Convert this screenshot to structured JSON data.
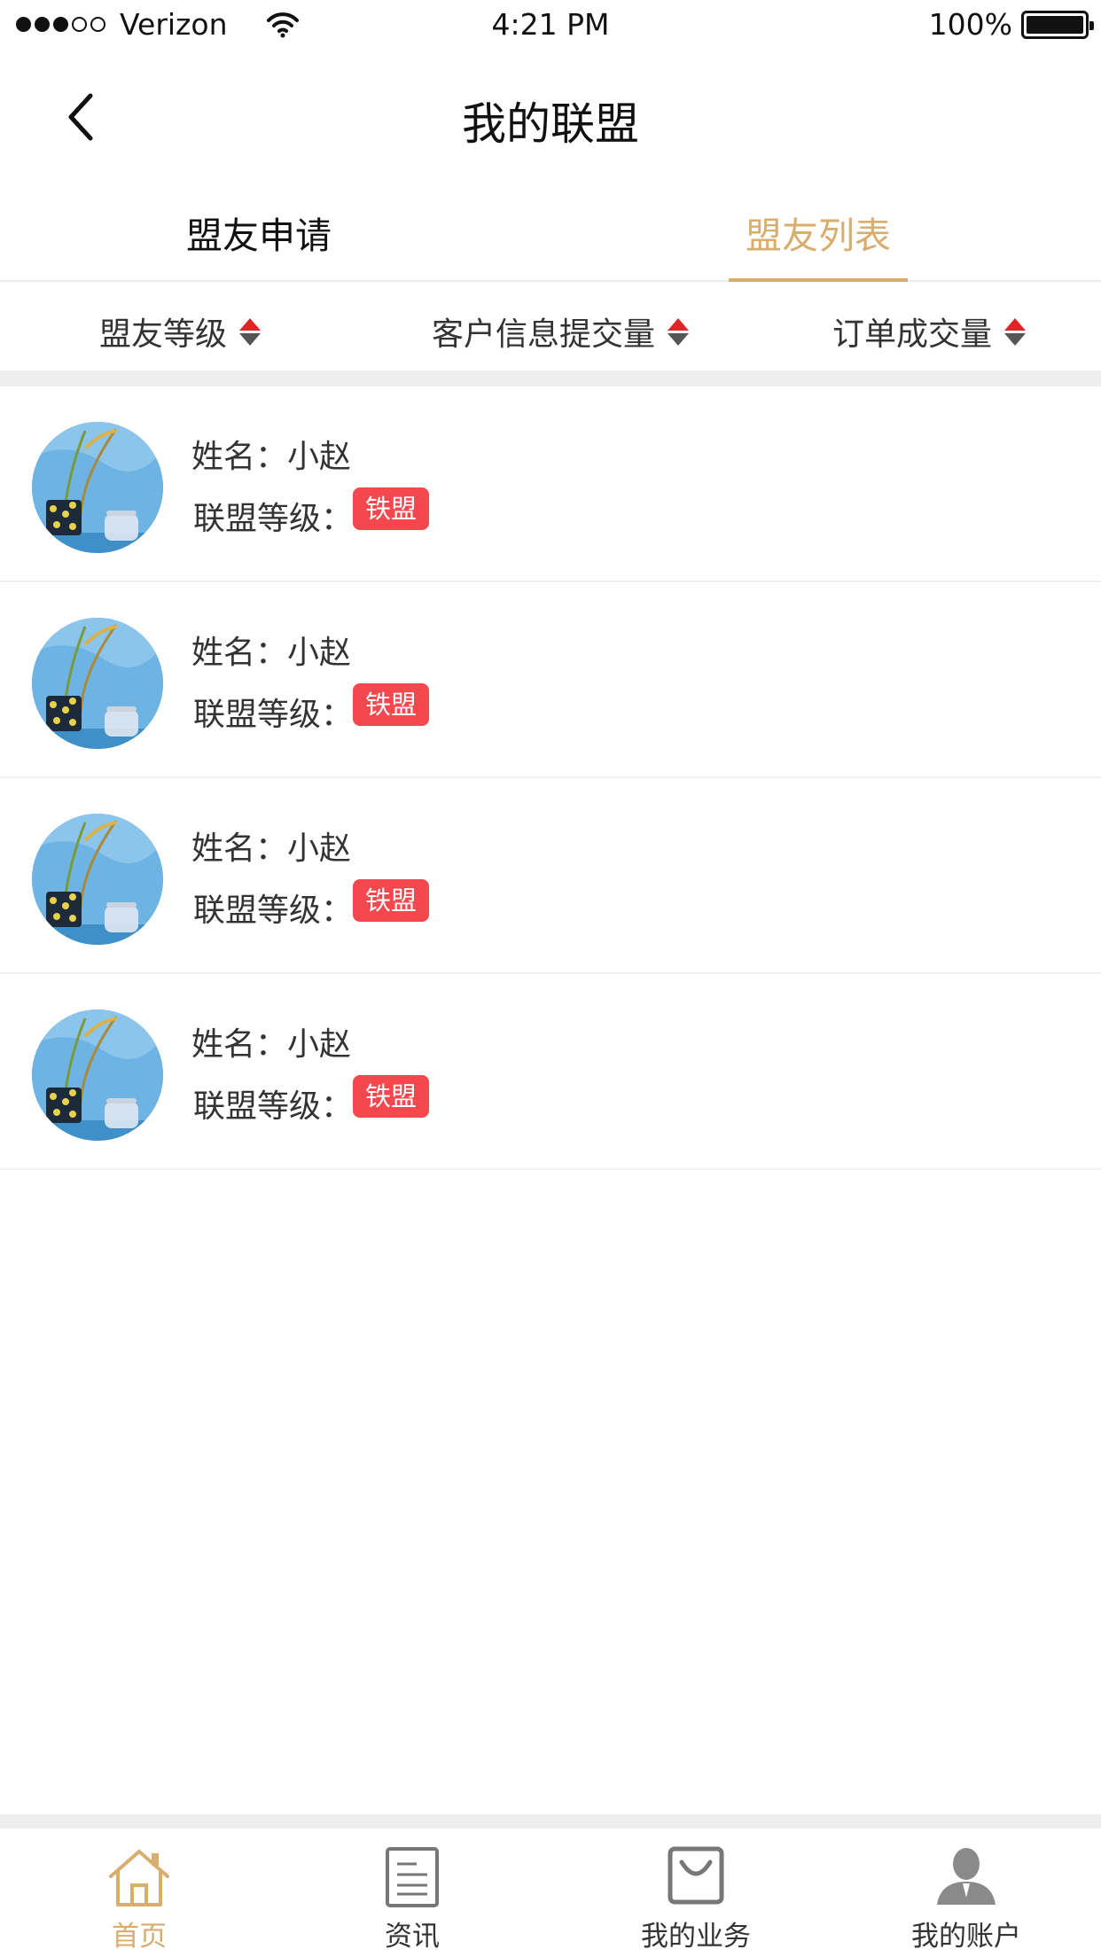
{
  "status_bar": {
    "carrier": "Verizon",
    "time": "4:21 PM",
    "battery": "100%"
  },
  "nav": {
    "title": "我的联盟",
    "back_icon": "chevron-left-icon"
  },
  "tabs": {
    "apply_label": "盟友申请",
    "list_label": "盟友列表",
    "active": "盟友列表"
  },
  "sort": {
    "items": [
      {
        "label": "盟友等级"
      },
      {
        "label": "客户信息提交量"
      },
      {
        "label": "订单成交量"
      }
    ]
  },
  "members": [
    {
      "name": "姓名：小赵",
      "level_label": "联盟等级：",
      "level": "铁盟"
    },
    {
      "name": "姓名：小赵",
      "level_label": "联盟等级：",
      "level": "铁盟"
    },
    {
      "name": "姓名：小赵",
      "level_label": "联盟等级：",
      "level": "铁盟"
    },
    {
      "name": "姓名：小赵",
      "level_label": "联盟等级：",
      "level": "铁盟"
    }
  ],
  "tabbar": {
    "items": [
      {
        "label": "首页",
        "icon": "home-icon",
        "active": true
      },
      {
        "label": "资讯",
        "icon": "document-icon",
        "active": false
      },
      {
        "label": "我的业务",
        "icon": "shopping-bag-icon",
        "active": false
      },
      {
        "label": "我的账户",
        "icon": "user-icon",
        "active": false
      }
    ]
  },
  "colors": {
    "accent": "#d9ad6e",
    "badge": "#f4484e",
    "sort_up": "#e02525",
    "sort_down": "#555555"
  }
}
